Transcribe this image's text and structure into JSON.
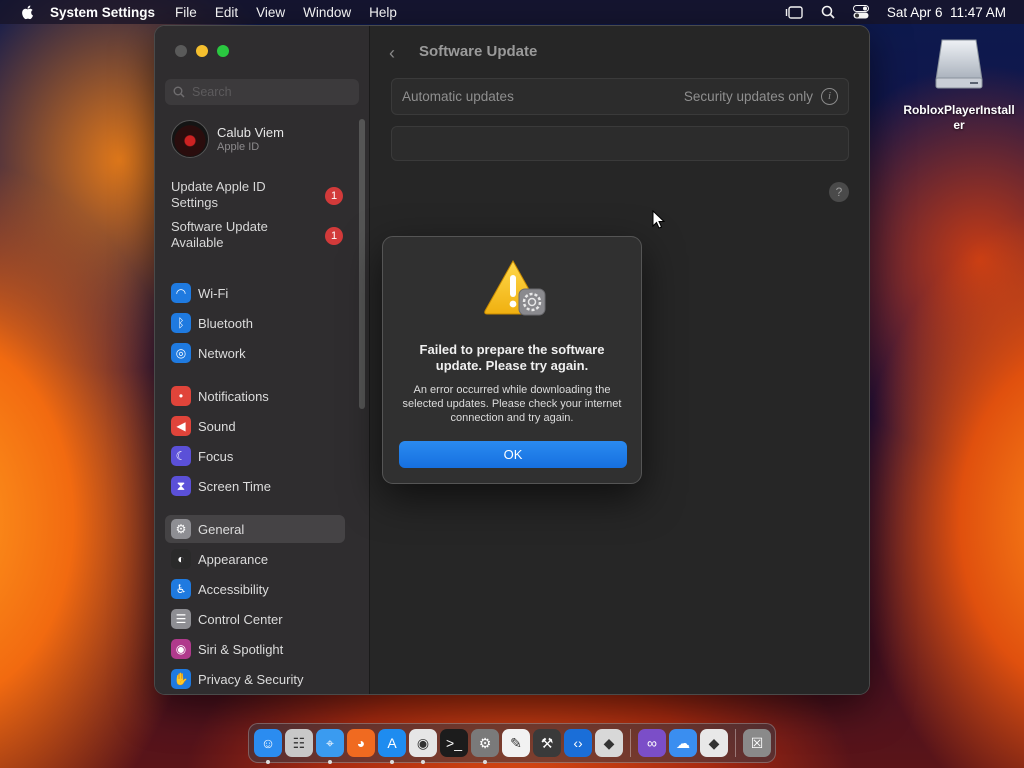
{
  "menubar": {
    "app_name": "System Settings",
    "menus": [
      "File",
      "Edit",
      "View",
      "Window",
      "Help"
    ],
    "clock": "Sat Apr 6  11:47 AM"
  },
  "desktop": {
    "items": [
      {
        "label": "RobloxPlayerInstaller",
        "icon": "external-drive-icon"
      }
    ]
  },
  "sidebar": {
    "search_placeholder": "Search",
    "account": {
      "name": "Calub Viem",
      "subtitle": "Apple ID"
    },
    "notices": [
      {
        "label": "Update Apple ID Settings",
        "badge": "1"
      },
      {
        "label": "Software Update Available",
        "badge": "1"
      }
    ],
    "items": [
      {
        "label": "Wi-Fi",
        "icon": "wifi-icon",
        "color": "#1f7ae0"
      },
      {
        "label": "Bluetooth",
        "icon": "bluetooth-icon",
        "color": "#1f7ae0"
      },
      {
        "label": "Network",
        "icon": "network-icon",
        "color": "#1f7ae0"
      },
      {
        "label": "Notifications",
        "icon": "bell-icon",
        "color": "#e0443a"
      },
      {
        "label": "Sound",
        "icon": "speaker-icon",
        "color": "#e0443a"
      },
      {
        "label": "Focus",
        "icon": "moon-icon",
        "color": "#5b50d8"
      },
      {
        "label": "Screen Time",
        "icon": "hourglass-icon",
        "color": "#5b50d8"
      },
      {
        "label": "General",
        "icon": "gear-icon",
        "color": "#8e8e93"
      },
      {
        "label": "Appearance",
        "icon": "appearance-icon",
        "color": "#2a2a2a"
      },
      {
        "label": "Accessibility",
        "icon": "accessibility-icon",
        "color": "#1f7ae0"
      },
      {
        "label": "Control Center",
        "icon": "control-center-icon",
        "color": "#8e8e93"
      },
      {
        "label": "Siri & Spotlight",
        "icon": "siri-icon",
        "color": "#b03a8c"
      },
      {
        "label": "Privacy & Security",
        "icon": "hand-icon",
        "color": "#1f7ae0"
      }
    ],
    "selected": "General"
  },
  "content": {
    "title": "Software Update",
    "automatic_updates_label": "Automatic updates",
    "automatic_updates_value": "Security updates only"
  },
  "dialog": {
    "title": "Failed to prepare the software update. Please try again.",
    "message": "An error occurred while downloading the selected updates. Please check your internet connection and try again.",
    "ok_label": "OK"
  },
  "dock": {
    "apps": [
      {
        "name": "finder-icon",
        "color": "#2b8cf0",
        "running": true
      },
      {
        "name": "launchpad-icon",
        "color": "#c8c8c8",
        "running": false
      },
      {
        "name": "safari-icon",
        "color": "#3a9bf0",
        "running": true
      },
      {
        "name": "firefox-icon",
        "color": "#f06a20",
        "running": false
      },
      {
        "name": "app-store-icon",
        "color": "#1e8cf0",
        "running": true
      },
      {
        "name": "chrome-icon",
        "color": "#e6e6e6",
        "running": true
      },
      {
        "name": "terminal-icon",
        "color": "#1c1c1c",
        "running": false
      },
      {
        "name": "system-settings-icon",
        "color": "#7a7a7a",
        "running": true
      },
      {
        "name": "textedit-icon",
        "color": "#f2f2f2",
        "running": false
      },
      {
        "name": "xcode-icon",
        "color": "#3a3a3a",
        "running": false
      },
      {
        "name": "vscode-icon",
        "color": "#1a6ed8",
        "running": false
      },
      {
        "name": "roblox-studio-icon",
        "color": "#d8d8d8",
        "running": false
      },
      {
        "name": "visual-studio-icon",
        "color": "#7b4ec8",
        "running": false
      },
      {
        "name": "icloud-drive-icon",
        "color": "#3a8ef0",
        "running": false
      },
      {
        "name": "roblox-icon",
        "color": "#e8e8e8",
        "running": false
      },
      {
        "name": "trash-icon",
        "color": "#8a8a8a",
        "running": false
      }
    ]
  }
}
